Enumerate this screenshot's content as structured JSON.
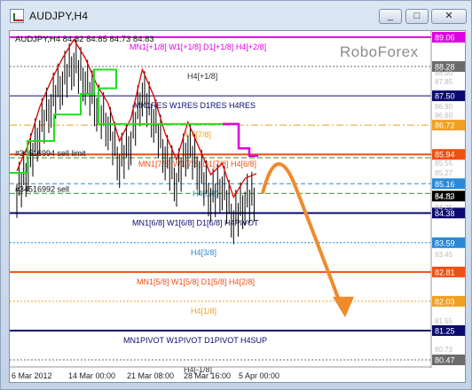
{
  "window": {
    "title": "AUDJPY,H4",
    "minimize": "_",
    "maximize": "□",
    "close": "✕",
    "icon": "chart-app-icon"
  },
  "chart": {
    "header": "AUDJPY,H4  84.82 84.85 84.73 84.83",
    "watermark": "RoboForex",
    "price_labels": [
      {
        "t": "89.06",
        "bg": "#e000e0",
        "fg": "#ffffff",
        "level": 89.06
      },
      {
        "t": "88.28",
        "bg": "#6b6b6b",
        "fg": "#ffffff",
        "level": 88.28
      },
      {
        "t": "87.50",
        "bg": "#0a0a70",
        "fg": "#ffffff",
        "level": 87.5
      },
      {
        "t": "86.72",
        "bg": "#f0a020",
        "fg": "#ffffff",
        "level": 86.72
      },
      {
        "t": "85.94",
        "bg": "#f05010",
        "fg": "#ffffff",
        "level": 85.94
      },
      {
        "t": "85.16",
        "bg": "#2a8ad8",
        "fg": "#ffffff",
        "level": 85.16
      },
      {
        "t": "84.83",
        "bg": "#000000",
        "fg": "#ffffff",
        "level": 84.83
      },
      {
        "t": "84.38",
        "bg": "#0a0a70",
        "fg": "#ffffff",
        "level": 84.38
      },
      {
        "t": "83.59",
        "bg": "#2a8ad8",
        "fg": "#ffffff",
        "level": 83.59
      },
      {
        "t": "82.81",
        "bg": "#f05010",
        "fg": "#ffffff",
        "level": 82.81
      },
      {
        "t": "82.03",
        "bg": "#f0a020",
        "fg": "#ffffff",
        "level": 82.03
      },
      {
        "t": "81.25",
        "bg": "#0a0a70",
        "fg": "#ffffff",
        "level": 81.25
      },
      {
        "t": "80.47",
        "bg": "#6b6b6b",
        "fg": "#ffffff",
        "level": 80.47
      }
    ],
    "partial_ticks": [
      "88.00",
      "87.85",
      "86.90",
      "86.60",
      "85.55",
      "85.27",
      "84.75",
      "84.25",
      "83.45",
      "81.55",
      "80.73"
    ],
    "level_lines": [
      {
        "label": "MN1[+1/8] W1[+1/8] D1[+1/8] H4[+2/8]",
        "level": 89.06,
        "color": "#e000e0",
        "style": "solid",
        "width": 2,
        "text_color": "#e000e0"
      },
      {
        "label": "H4[+1/8]",
        "level": 88.28,
        "color": "#6b6b6b",
        "style": "dotted",
        "width": 1,
        "text_color": "#333333"
      },
      {
        "label": "MN1RES W1RES D1RES H4RES",
        "level": 87.5,
        "color": "#0a0a70",
        "style": "solid",
        "width": 1,
        "text_color": "#0a0a70"
      },
      {
        "label": "H4[7/8]",
        "level": 86.72,
        "color": "#f0a020",
        "style": "dashdot",
        "width": 1,
        "text_color": "#f0a020"
      },
      {
        "label": "MN1[7/8] W1[7/8] D1[7/8] H4[6/8]",
        "level": 85.94,
        "color": "#f05010",
        "style": "solid",
        "width": 2,
        "text_color": "#f05010"
      },
      {
        "label": "H4[5/8]",
        "level": 85.16,
        "color": "#2a8ad8",
        "style": "dashed",
        "width": 1,
        "text_color": "#2a8ad8"
      },
      {
        "label": "MN1[6/8] W1[6/8] D1[6/8] H4PIVOT",
        "level": 84.38,
        "color": "#0a0a70",
        "style": "solid",
        "width": 2,
        "text_color": "#0a0a70"
      },
      {
        "label": "H4[3/8]",
        "level": 83.59,
        "color": "#2a8ad8",
        "style": "dotted",
        "width": 1,
        "text_color": "#2a8ad8"
      },
      {
        "label": "MN1[5/8] W1[5/8] D1[5/8] H4[2/8]",
        "level": 82.81,
        "color": "#f05010",
        "style": "solid",
        "width": 2,
        "text_color": "#f05010"
      },
      {
        "label": "H4[1/8]",
        "level": 82.03,
        "color": "#f0a020",
        "style": "dotted",
        "width": 1,
        "text_color": "#f0a020"
      },
      {
        "label": "MN1PIVOT W1PIVOT D1PIVOT H4SUP",
        "level": 81.25,
        "color": "#0a0a70",
        "style": "solid",
        "width": 2,
        "text_color": "#0a0a70"
      },
      {
        "label": "H4[-1/8]",
        "level": 80.47,
        "color": "#6b6b6b",
        "style": "dotted",
        "width": 1,
        "text_color": "#333333"
      }
    ],
    "orders": [
      {
        "label": "#34516994 sell limit",
        "level": 85.85
      },
      {
        "label": "#34516992 sell",
        "level": 84.9
      }
    ],
    "x_labels": [
      "6 Mar 2012",
      "14 Mar 00:00",
      "21 Mar 08:00",
      "28 Mar 16:00",
      "5 Apr 00:00"
    ],
    "colors": {
      "green_line": "#22dd22",
      "magenta_line": "#e000e0",
      "red_line": "#dd0000",
      "forecast_arrow": "#f08a2a",
      "candles": "#000000"
    },
    "forecast": "arrow-down"
  },
  "chart_data": {
    "type": "line",
    "title": "AUDJPY,H4",
    "x": [
      "6 Mar 2012",
      "14 Mar 00:00",
      "21 Mar 08:00",
      "28 Mar 16:00",
      "5 Apr 00:00"
    ],
    "ylim": [
      80.2,
      89.2
    ],
    "series": [
      {
        "values": [
          84.9,
          85.6,
          86.6,
          87.3,
          87.9,
          88.4,
          87.9,
          87.2,
          86.7,
          85.7,
          86.3,
          87.6,
          86.9,
          85.9,
          85.2,
          86.2,
          85.5,
          84.8,
          85.1,
          84.2,
          84.7,
          84.83
        ]
      }
    ]
  }
}
